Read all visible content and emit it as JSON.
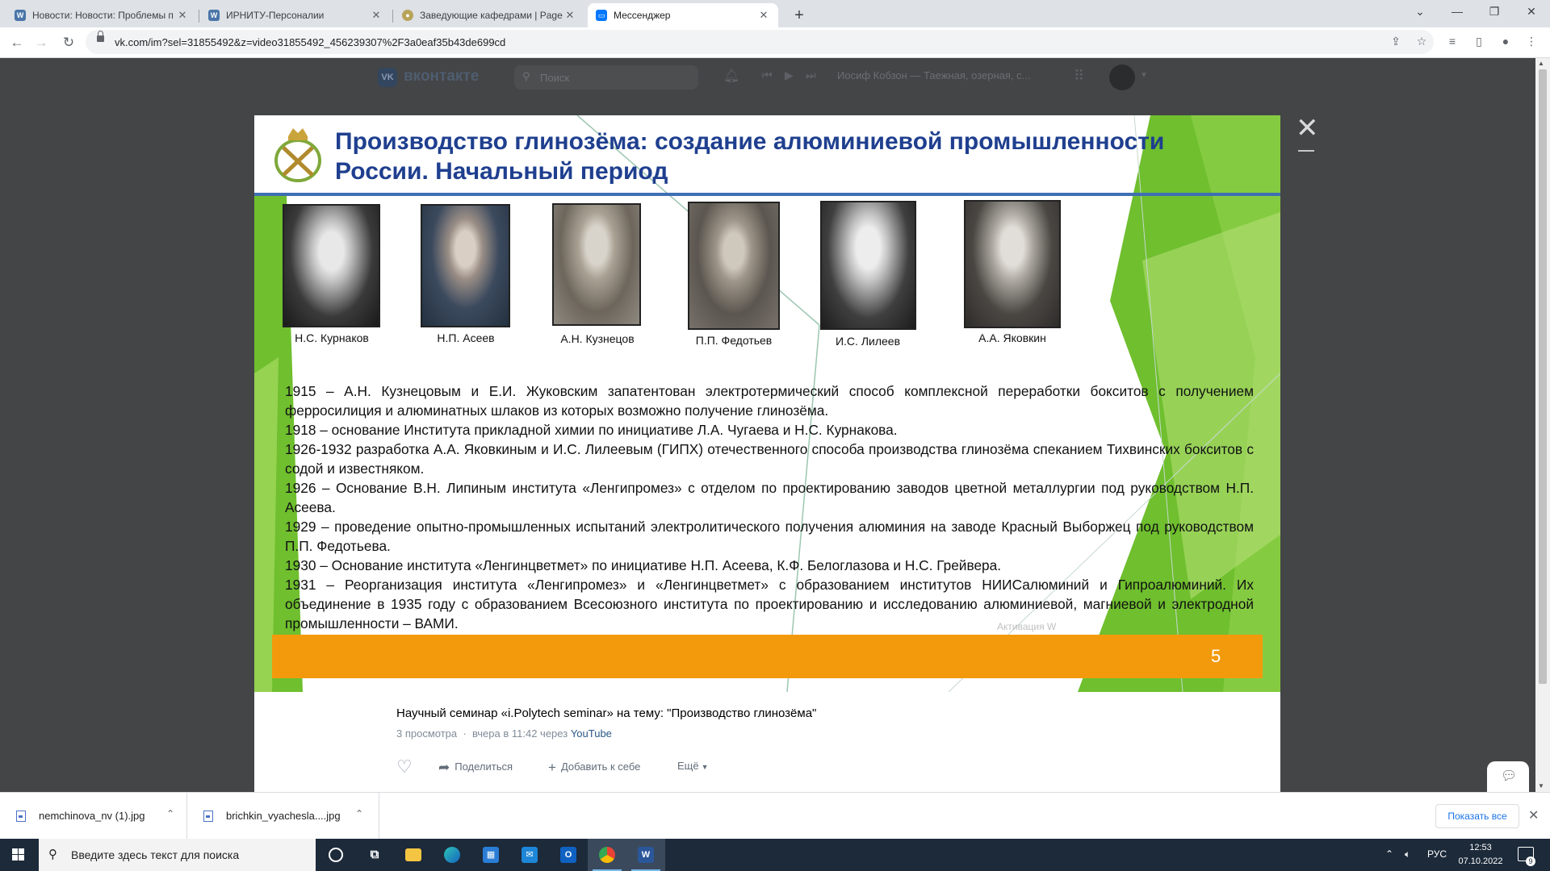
{
  "browser": {
    "tabs": [
      {
        "title": "Новости: Новости: Проблемы п",
        "favicon": "vk-news-icon",
        "active": false
      },
      {
        "title": "ИРНИТУ-Персоналии",
        "favicon": "irnitu-icon",
        "active": false
      },
      {
        "title": "Заведующие кафедрами | Page",
        "favicon": "pages-icon",
        "active": false
      },
      {
        "title": "Мессенджер",
        "favicon": "vk-icon",
        "active": true
      }
    ],
    "url": "vk.com/im?sel=31855492&z=video31855492_456239307%2F3a0eaf35b43de699cd"
  },
  "vk": {
    "brand": "вконтакте",
    "search_placeholder": "Поиск",
    "now_playing": "Иосиф Кобзон — Таежная, озерная, с..."
  },
  "slide": {
    "title": "Производство глинозёма: создание алюминиевой промышленности России. Начальный период",
    "people": [
      "Н.С. Курнаков",
      "Н.П. Асеев",
      "А.Н. Кузнецов",
      "П.П. Федотьев",
      "И.С. Лилеев",
      "А.А. Яковкин"
    ],
    "paragraphs": [
      "1915 – А.Н. Кузнецовым и Е.И. Жуковским запатентован электротермический способ комплексной переработки бокситов с получением ферросилиция и алюминатных шлаков из которых возможно получение глинозёма.",
      "1918 – основание Института прикладной химии по инициативе Л.А. Чугаева и Н.С. Курнакова.",
      "1926-1932 разработка А.А. Яковкиным и И.С. Лилеевым (ГИПХ) отечественного способа производства глинозёма спеканием Тихвинских бокситов с содой и известняком.",
      "1926 – Основание В.Н. Липиным института «Ленгипромез» с отделом по проектированию заводов цветной металлургии под руководством Н.П. Асеева.",
      "1929 – проведение опытно-промышленных испытаний электролитического получения алюминия на заводе Красный Выборжец под руководством П.П. Федотьева.",
      "1930 – Основание института «Ленгинцветмет» по инициативе Н.П. Асеева, К.Ф. Белоглазова и Н.С. Грейвера.",
      "1931 – Реорганизация института «Ленгипромез» и «Ленгинцветмет» с образованием институтов НИИСалюминий и Гипроалюминий. Их объединение в 1935 году с образованием Всесоюзного института по проектированию  и исследованию алюминиевой, магниевой и электродной промышленности – ВАМИ."
    ],
    "watermark": "Активация W",
    "page_number": "5"
  },
  "video": {
    "title": "Научный семинар «i.Polytech seminar» на тему: \"Производство глинозёма\"",
    "views": "3 просмотра",
    "sep": "·",
    "posted": "вчера в 11:42 через",
    "source": "YouTube",
    "actions": {
      "share": "Поделиться",
      "add": "Добавить к себе",
      "more": "Ещё"
    }
  },
  "downloads": {
    "files": [
      "nemchinova_nv (1).jpg",
      "brichkin_vyachesla....jpg"
    ],
    "show_all": "Показать все"
  },
  "taskbar": {
    "search_placeholder": "Введите здесь текст для поиска",
    "lang": "РУС",
    "time": "12:53",
    "date": "07.10.2022",
    "notifications": "9"
  },
  "colors": {
    "title_blue": "#1f3f8f",
    "slide_green": "#6fbf2e",
    "orange_bar": "#f39a0c",
    "vk_dim_bg": "#444546"
  }
}
